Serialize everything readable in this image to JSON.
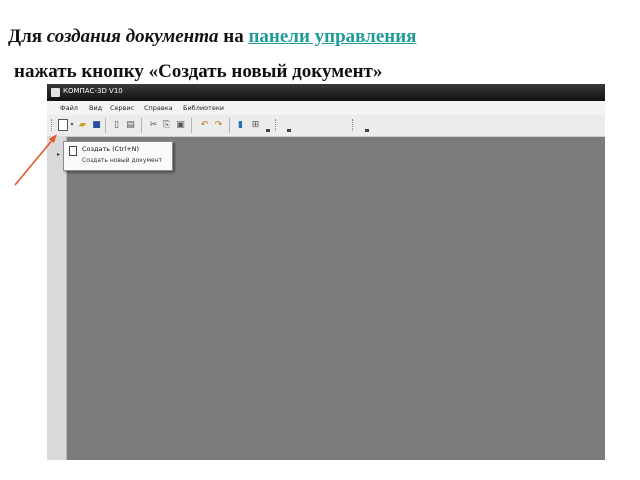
{
  "caption": {
    "part1": "Для ",
    "part2_italic": "создания документа",
    "part3": " на ",
    "link": "панели управления",
    "line2": "нажать кнопку «Создать новый документ»"
  },
  "window": {
    "title": "КОМПАС-3D V10"
  },
  "menu": {
    "items": [
      {
        "label": "Файл"
      },
      {
        "label": "Вид"
      },
      {
        "label": "Сервис"
      },
      {
        "label": "Справка"
      },
      {
        "label": "Библиотеки"
      }
    ]
  },
  "dropdown": {
    "label": "Создать (Ctrl+N)",
    "description": "Создать новый документ"
  },
  "colors": {
    "caption_link": "#1f9c97",
    "arrow": "#e05a2a",
    "workspace": "#7b7b7b"
  }
}
